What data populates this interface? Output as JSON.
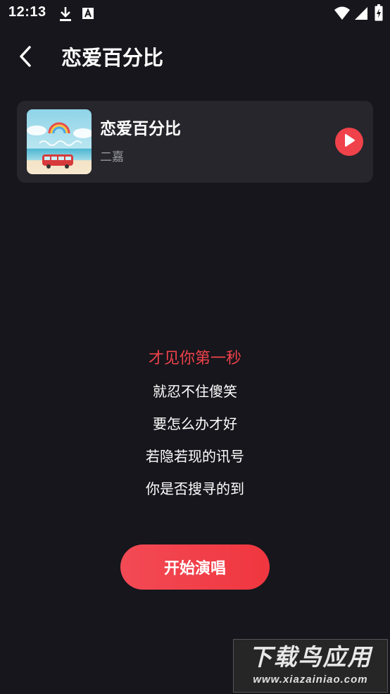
{
  "status_bar": {
    "time": "12:13",
    "icons": [
      "download-icon",
      "font-a-icon",
      "wifi-icon",
      "signal-icon",
      "battery-icon"
    ]
  },
  "header": {
    "back_icon": "chevron-left-icon",
    "title": "恋爱百分比"
  },
  "song_card": {
    "cover_icon": "album-cover",
    "title": "恋爱百分比",
    "artist": "二嘉",
    "play_icon": "play-icon"
  },
  "lyrics": {
    "lines": [
      "才见你第一秒",
      "就忍不住傻笑",
      "要怎么办才好",
      "若隐若现的讯号",
      "你是否搜寻的到"
    ],
    "active_index": 0
  },
  "start_button": {
    "label": "开始演唱"
  },
  "watermark": {
    "title": "下载鸟应用",
    "url": "www.xiazainiao.com"
  },
  "colors": {
    "background": "#16161c",
    "card": "#26262c",
    "accent": "#f0424a",
    "text": "#ffffff",
    "subtext": "#9a9aa2"
  }
}
